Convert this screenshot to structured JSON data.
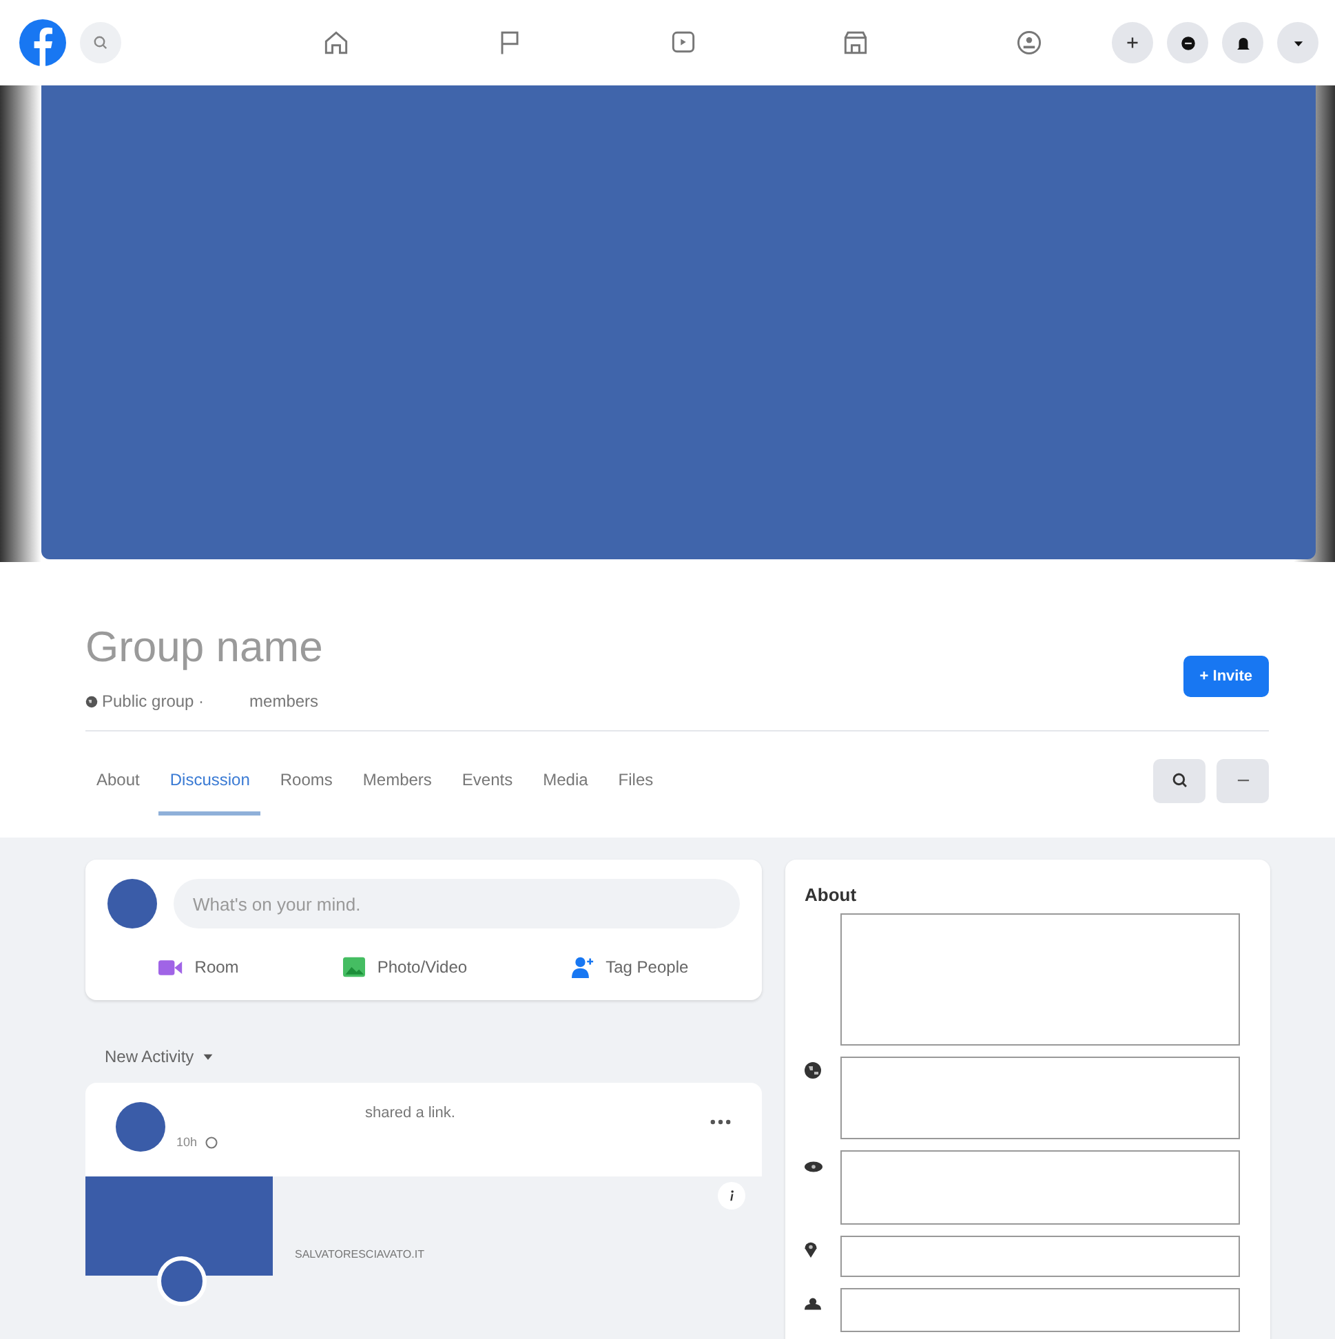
{
  "topbar": {
    "nav": [
      {
        "kind": "home",
        "selected": false
      },
      {
        "kind": "flag",
        "selected": false
      },
      {
        "kind": "video",
        "selected": false
      },
      {
        "kind": "store",
        "selected": false
      },
      {
        "kind": "groups",
        "selected": false
      }
    ],
    "actions": [
      {
        "kind": "plus"
      },
      {
        "kind": "messenger"
      },
      {
        "kind": "bell"
      },
      {
        "kind": "caret"
      }
    ]
  },
  "group": {
    "name": "Group name",
    "privacy": "Public group ·",
    "members": "members",
    "invite": "+ Invite"
  },
  "tabs": [
    {
      "label": "About",
      "selected": false
    },
    {
      "label": "Discussion",
      "selected": true
    },
    {
      "label": "Rooms",
      "selected": false
    },
    {
      "label": "Members",
      "selected": false
    },
    {
      "label": "Events",
      "selected": false
    },
    {
      "label": "Media",
      "selected": false
    },
    {
      "label": "Files",
      "selected": false
    }
  ],
  "composer": {
    "placeholder": "What's on your mind.",
    "actions": [
      {
        "kind": "room",
        "label": "Room"
      },
      {
        "kind": "photo",
        "label": "Photo/Video"
      },
      {
        "kind": "tag",
        "label": "Tag People"
      }
    ]
  },
  "feed": {
    "sort": "New Activity",
    "post": {
      "action": "shared a link.",
      "time": "10h",
      "link_domain": "SALVATORESCIAVATO.IT"
    }
  },
  "about": {
    "title": "About",
    "fields": [
      {
        "kind": "description"
      },
      {
        "kind": "globe"
      },
      {
        "kind": "eye"
      },
      {
        "kind": "location"
      },
      {
        "kind": "group"
      }
    ]
  }
}
